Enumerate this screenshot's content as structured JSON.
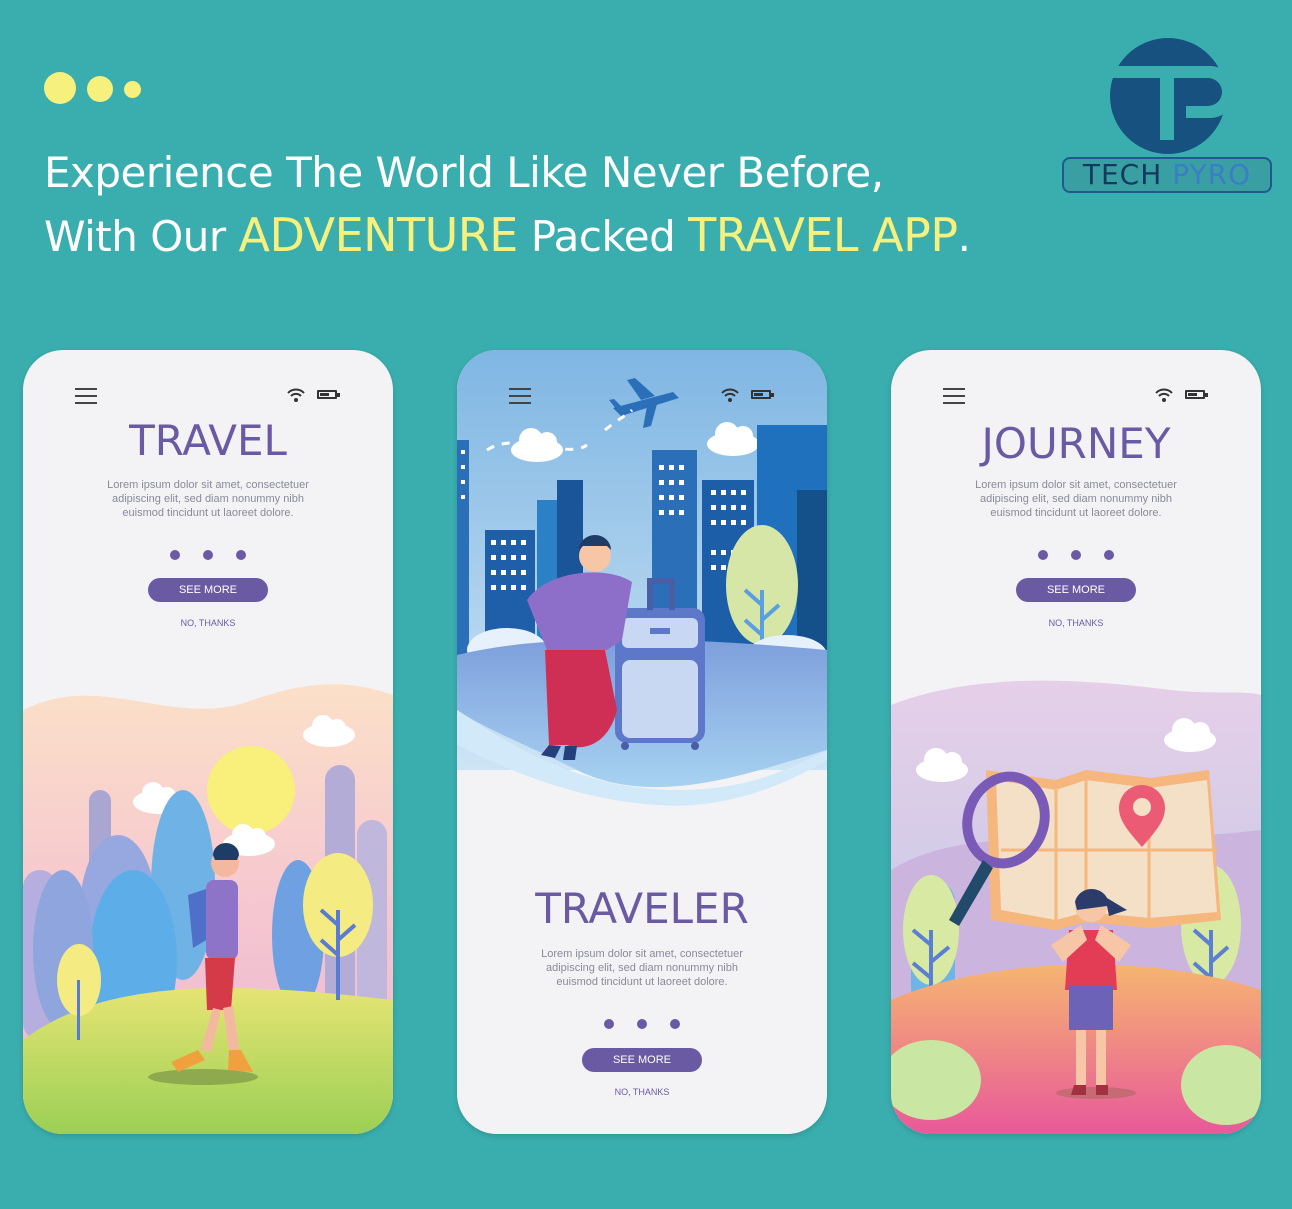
{
  "header": {
    "line1": "Experience The World Like Never Before,",
    "line2_a": "With Our ",
    "line2_hl1": "ADVENTURE",
    "line2_b": " Packed ",
    "line2_hl2": "TRAVEL APP",
    "line2_c": "."
  },
  "logo": {
    "word1": "TECH",
    "word2": "PYRO"
  },
  "colors": {
    "background": "#3aaeae",
    "accent": "#f6f07c",
    "brand_purple": "#6a5aa3",
    "logo_blue": "#1f5a8f"
  },
  "phones": [
    {
      "title": "TRAVEL",
      "lorem": [
        "Lorem ipsum dolor sit amet, consectetuer",
        "adipiscing elit, sed diam nonummy nibh",
        "euismod tincidunt ut laoreet dolore."
      ],
      "button": "SEE MORE",
      "dismiss": "NO, THANKS"
    },
    {
      "title": "TRAVELER",
      "lorem": [
        "Lorem ipsum dolor sit amet, consectetuer",
        "adipiscing elit, sed diam nonummy nibh",
        "euismod tincidunt ut laoreet dolore."
      ],
      "button": "SEE MORE",
      "dismiss": "NO, THANKS"
    },
    {
      "title": "JOURNEY",
      "lorem": [
        "Lorem ipsum dolor sit amet, consectetuer",
        "adipiscing elit, sed diam nonummy nibh",
        "euismod tincidunt ut laoreet dolore."
      ],
      "button": "SEE MORE",
      "dismiss": "NO, THANKS"
    }
  ],
  "icons": {
    "menu": "hamburger-icon",
    "wifi": "wifi-icon",
    "battery": "battery-icon",
    "plane": "airplane-icon",
    "pin": "location-pin-icon",
    "magnifier": "magnifier-icon"
  }
}
